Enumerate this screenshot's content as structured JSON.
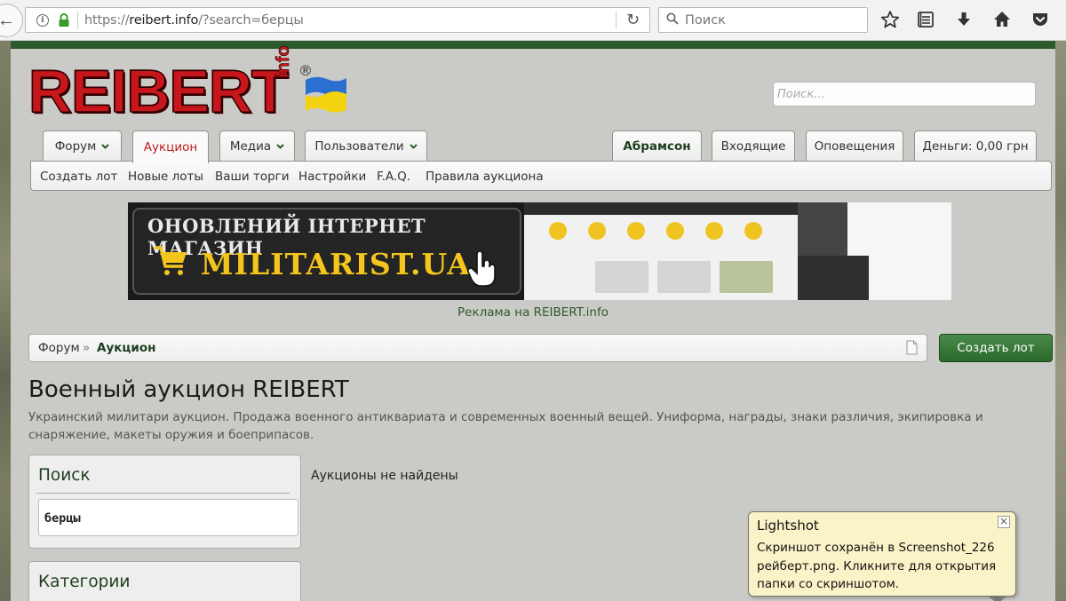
{
  "browser": {
    "url_host": "reibert.info",
    "url_prefix": "https://",
    "url_rest": "/?search=берцы",
    "search_placeholder": "Поиск"
  },
  "header": {
    "logo_text": "REIBERT",
    "logo_suffix": "info",
    "logo_reg": "®",
    "search_placeholder": "Поиск...",
    "accent_color": "#c8161d",
    "brand_green": "#2c5a2c"
  },
  "nav": {
    "tabs": [
      {
        "label": "Форум"
      },
      {
        "label": "Аукцион"
      },
      {
        "label": "Медиа"
      },
      {
        "label": "Пользователи"
      }
    ],
    "user_tabs": [
      {
        "label": "Абрамсон"
      },
      {
        "label": "Входящие"
      },
      {
        "label": "Оповещения"
      },
      {
        "label": "Деньги: 0,00 грн"
      }
    ],
    "subnav": [
      "Создать лот",
      "Новые лоты",
      "Ваши торги",
      "Настройки",
      "F.A.Q.",
      "Правила аукциона"
    ]
  },
  "ad": {
    "line1": "ОНОВЛЕНИЙ ІНТЕРНЕТ МАГАЗИН",
    "line2": "MILITARIST.UA",
    "caption": "Реклама на REIBERT.info"
  },
  "breadcrumb": {
    "home": "Форум",
    "sep": "»",
    "current": "Аукцион"
  },
  "create_button": "Создать лот",
  "main": {
    "title": "Военный аукцион REIBERT",
    "description": "Украинский милитари аукцион. Продажа военного антиквариата и современных военный вещей. Униформа, награды, знаки различия, экипировка и снаряжение, макеты оружия и боеприпасов.",
    "no_results": "Аукционы не найдены"
  },
  "sidebar": {
    "search_title": "Поиск",
    "search_value": "берцы",
    "categories_title": "Категории"
  },
  "lightshot": {
    "title": "Lightshot",
    "close": "×",
    "body": "Скриншот сохранён в Screenshot_226 рейберт.png. Кликните для открытия папки со скриншотом."
  }
}
